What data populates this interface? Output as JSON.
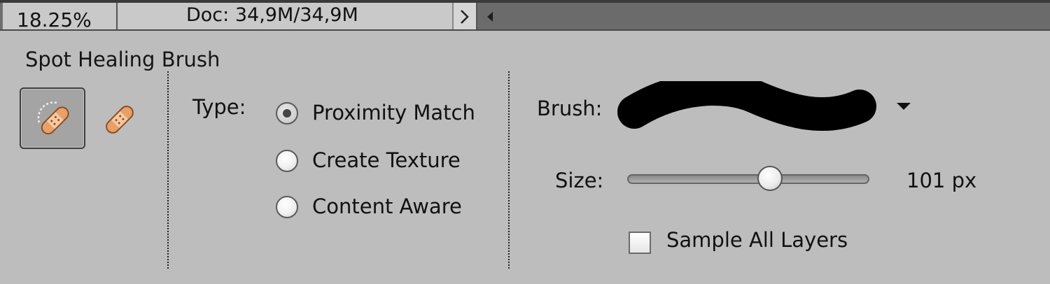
{
  "status_bar": {
    "zoom": "18.25%",
    "doc_info": "Doc: 34,9M/34,9M",
    "expand_arrow_icon": "chevron-right-icon",
    "scroll_left_icon": "triangle-left-icon"
  },
  "tool_options": {
    "tool_name": "Spot Healing Brush",
    "tools": [
      {
        "name": "Spot Healing Brush",
        "icon": "spot-healing-brush-icon",
        "selected": true
      },
      {
        "name": "Healing Brush",
        "icon": "healing-brush-icon",
        "selected": false
      }
    ],
    "type": {
      "label": "Type:",
      "options": [
        {
          "label": "Proximity Match",
          "checked": true
        },
        {
          "label": "Create Texture",
          "checked": false
        },
        {
          "label": "Content Aware",
          "checked": false
        }
      ]
    },
    "brush": {
      "label": "Brush:",
      "preview_icon": "brush-stroke-preview",
      "dropdown_icon": "triangle-down-icon"
    },
    "size": {
      "label": "Size:",
      "value_text": "101 px",
      "slider_fraction": 0.59
    },
    "sample_all_layers": {
      "label": "Sample All Layers",
      "checked": false
    }
  },
  "colors": {
    "panel_bg": "#bdbdbd",
    "statusbar_bg": "#6d6d6d",
    "bandage_orange": "#e8a06a"
  }
}
